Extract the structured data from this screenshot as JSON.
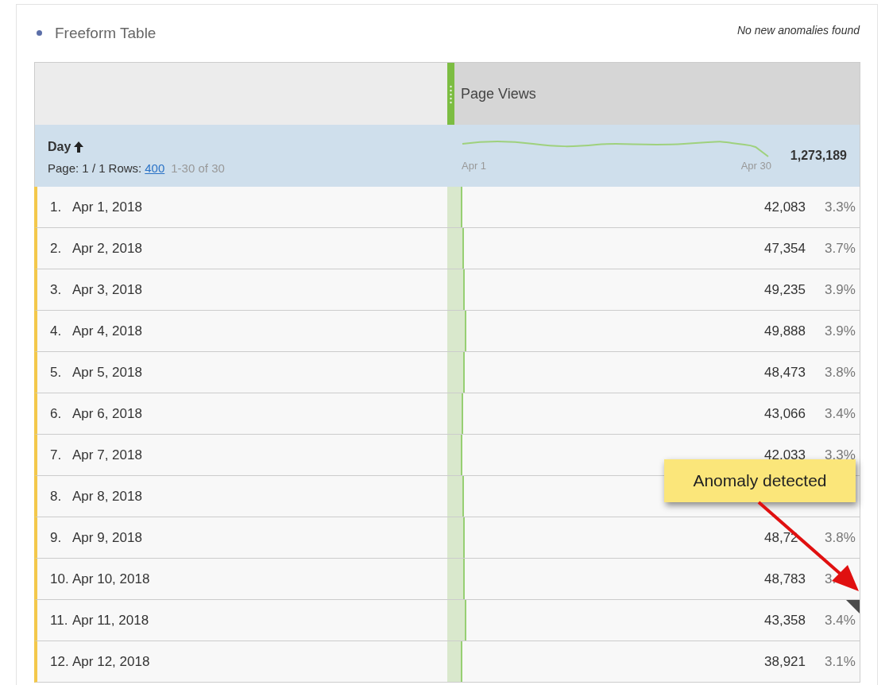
{
  "panel": {
    "title": "Freeform Table",
    "status": "No new anomalies found"
  },
  "table": {
    "column_header": "Page Views",
    "dimension": "Day",
    "page_label": "Page: 1 / 1",
    "rows_label": "Rows:",
    "rows_value": "400",
    "range": "1-30 of 30",
    "sparkline_start": "Apr 1",
    "sparkline_end": "Apr 30",
    "total": "1,273,189",
    "rows": [
      {
        "index": "1.",
        "date": "Apr 1, 2018",
        "value": "42,083",
        "percent": "3.3%",
        "level": 0.037,
        "anomaly": false
      },
      {
        "index": "2.",
        "date": "Apr 2, 2018",
        "value": "47,354",
        "percent": "3.7%",
        "level": 0.04,
        "anomaly": false
      },
      {
        "index": "3.",
        "date": "Apr 3, 2018",
        "value": "49,235",
        "percent": "3.9%",
        "level": 0.043,
        "anomaly": false
      },
      {
        "index": "4.",
        "date": "Apr 4, 2018",
        "value": "49,888",
        "percent": "3.9%",
        "level": 0.047,
        "anomaly": false
      },
      {
        "index": "5.",
        "date": "Apr 5, 2018",
        "value": "48,473",
        "percent": "3.8%",
        "level": 0.043,
        "anomaly": false
      },
      {
        "index": "6.",
        "date": "Apr 6, 2018",
        "value": "43,066",
        "percent": "3.4%",
        "level": 0.038,
        "anomaly": false
      },
      {
        "index": "7.",
        "date": "Apr 7, 2018",
        "value": "42,033",
        "percent": "3.3%",
        "level": 0.037,
        "anomaly": false
      },
      {
        "index": "8.",
        "date": "Apr 8, 2018",
        "level": 0.04,
        "anomaly": false
      },
      {
        "index": "9.",
        "date": "Apr 9, 2018",
        "value": "48,72",
        "percent": "3.8%",
        "level": 0.042,
        "anomaly": false
      },
      {
        "index": "10.",
        "date": "Apr 10, 2018",
        "value": "48,783",
        "percent": "3.",
        "level": 0.042,
        "anomaly": false
      },
      {
        "index": "11.",
        "date": "Apr 11, 2018",
        "value": "43,358",
        "percent": "3.4%",
        "level": 0.047,
        "anomaly": true
      },
      {
        "index": "12.",
        "date": "Apr 12, 2018",
        "value": "38,921",
        "percent": "3.1%",
        "level": 0.037,
        "anomaly": false
      }
    ]
  },
  "callout": {
    "text": "Anomaly detected"
  }
}
